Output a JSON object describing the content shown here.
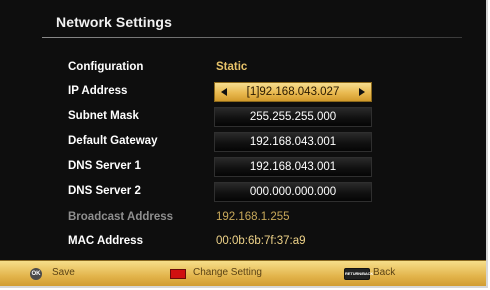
{
  "header": {
    "title": "Network Settings"
  },
  "rows": [
    {
      "label": "Configuration",
      "value": "Static"
    },
    {
      "label": "IP Address",
      "value": "[1]92.168.043.027"
    },
    {
      "label": "Subnet Mask",
      "value": "255.255.255.000"
    },
    {
      "label": "Default Gateway",
      "value": "192.168.043.001"
    },
    {
      "label": "DNS Server 1",
      "value": "192.168.043.001"
    },
    {
      "label": "DNS Server 2",
      "value": "000.000.000.000"
    },
    {
      "label": "Broadcast Address",
      "value": "192.168.1.255"
    },
    {
      "label": "MAC Address",
      "value": "00:0b:6b:7f:37:a9"
    }
  ],
  "footer": {
    "ok_key": "OK",
    "save_label": "Save",
    "change_label": "Change Setting",
    "return_key": "RETURN/BACK",
    "back_label": "Back"
  },
  "colors": {
    "accent_gold": "#e9b950",
    "value_gold": "#e8c36a",
    "background": "#0e0e0e",
    "red_key": "#d01010"
  },
  "icons": {
    "left": "triangle-left-icon",
    "right": "triangle-right-icon",
    "ok": "ok-button-icon",
    "red": "red-key-icon",
    "return": "return-key-icon"
  }
}
